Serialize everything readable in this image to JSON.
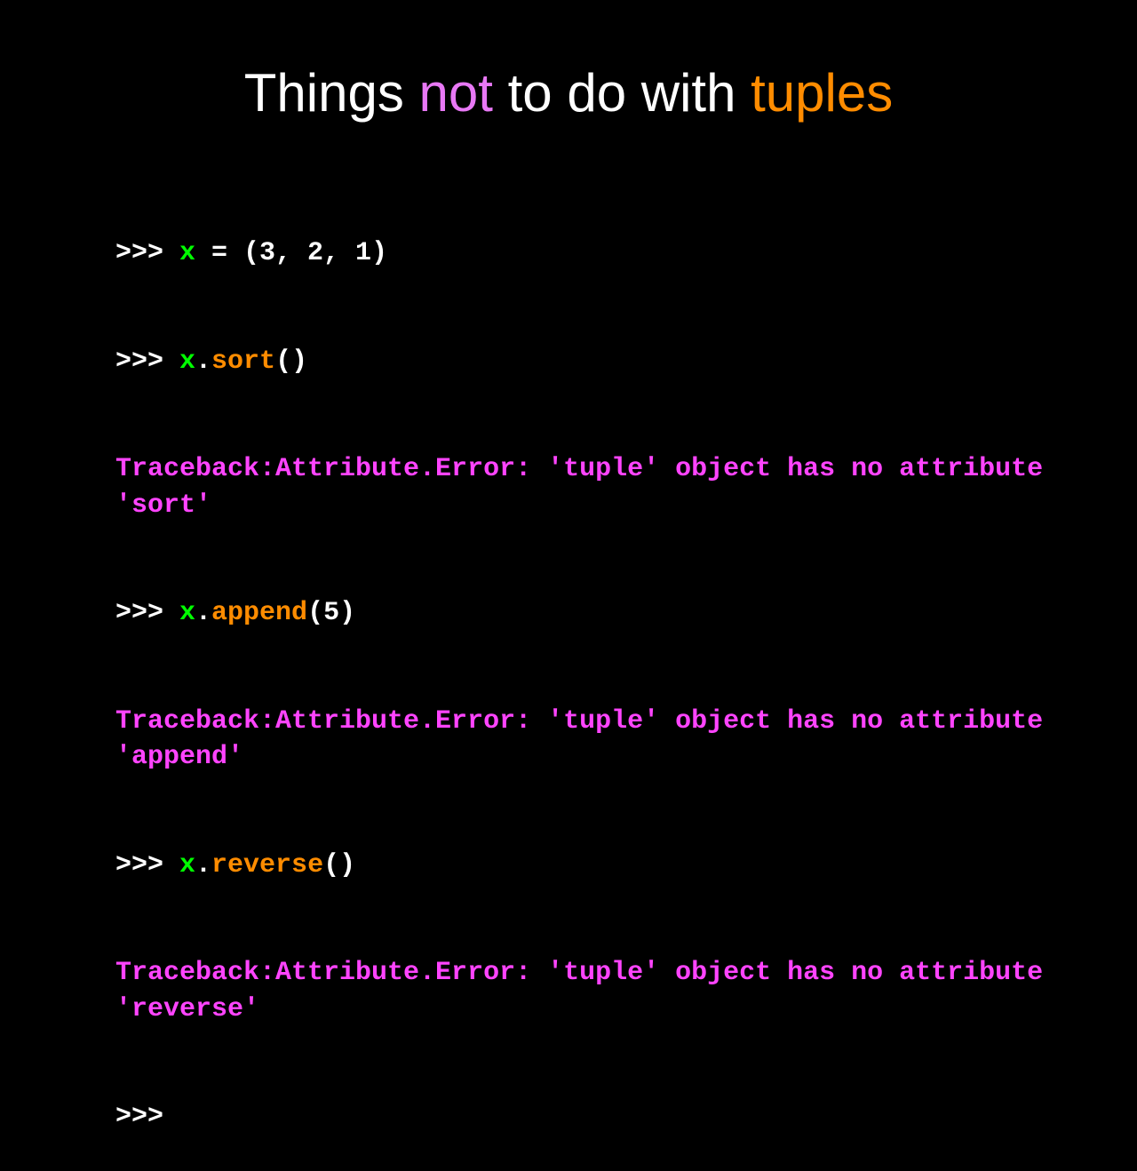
{
  "title": {
    "part1": "Things ",
    "not": "not",
    "part2": " to do with ",
    "tuples": "tuples"
  },
  "code": {
    "l1": {
      "prompt": ">>> ",
      "var": "x",
      "rest": " = (3, 2, 1)"
    },
    "l2": {
      "prompt": ">>> ",
      "var": "x",
      "dot": ".",
      "method": "sort",
      "parens": "()"
    },
    "l3": "Traceback:Attribute.Error: 'tuple' object has no attribute 'sort'",
    "l4": {
      "prompt": ">>> ",
      "var": "x",
      "dot": ".",
      "method": "append",
      "parens": "(5)"
    },
    "l5": "Traceback:Attribute.Error: 'tuple' object has no attribute 'append'",
    "l6": {
      "prompt": ">>> ",
      "var": "x",
      "dot": ".",
      "method": "reverse",
      "parens": "()"
    },
    "l7": "Traceback:Attribute.Error: 'tuple' object has no attribute 'reverse'",
    "l8": ">>>"
  }
}
